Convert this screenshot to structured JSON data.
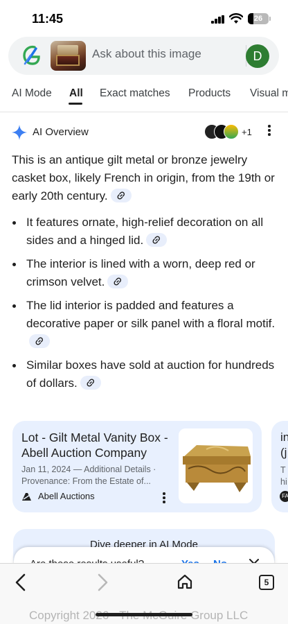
{
  "status_bar": {
    "time": "11:45",
    "battery": "26",
    "battery_level": 0.26
  },
  "search": {
    "placeholder": "Ask about this image",
    "avatar_letter": "D"
  },
  "tabs": [
    {
      "label": "AI Mode"
    },
    {
      "label": "All",
      "active": true
    },
    {
      "label": "Exact matches"
    },
    {
      "label": "Products"
    },
    {
      "label": "Visual m"
    }
  ],
  "ai_overview": {
    "title": "AI Overview",
    "sources_more": "+1",
    "intro": "This is an antique gilt metal or bronze jewelry casket box, likely French in origin, from the 19th or early 20th century.",
    "bullets": [
      "It features ornate, high-relief decoration on all sides and a hinged lid.",
      "The interior is lined with a worn, deep red or crimson velvet.",
      "The lid interior is padded and features a decorative paper or silk panel with a floral motif.",
      "Similar boxes have sold at auction for hundreds of dollars."
    ]
  },
  "cards": [
    {
      "title": "Lot - Gilt Metal Vanity Box - Abell Auction Company",
      "date": "Jan 11, 2024 — Additional Details ·",
      "snippet": "Provenance: From the Estate of...",
      "source": "Abell Auctions"
    }
  ],
  "card_partial": {
    "line1": "in",
    "line2": "(j",
    "line3": "T",
    "line4": "hi",
    "badge": "FA"
  },
  "dive_deeper": {
    "label": "Dive deeper in AI Mode"
  },
  "feedback": {
    "question": "Are these results useful?",
    "yes": "Yes",
    "no": "No"
  },
  "toolbar": {
    "tab_count": "5"
  },
  "watermark": "Copyright 2026 - The McGuire Group LLC",
  "colors": {
    "accent": "#1a73e8",
    "card_bg": "#e8f0fe",
    "avatar": "#2e7d32",
    "search_bg": "#f1f3f4"
  }
}
